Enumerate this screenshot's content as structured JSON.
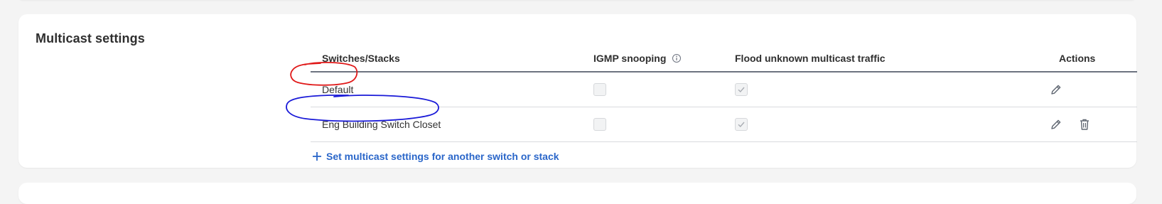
{
  "section": {
    "title": "Multicast settings"
  },
  "table": {
    "columns": {
      "switches": "Switches/Stacks",
      "igmp": "IGMP snooping",
      "flood": "Flood unknown multicast traffic",
      "actions": "Actions"
    },
    "rows": [
      {
        "name": "Default",
        "igmp_snooping": false,
        "flood_unknown": true,
        "actions": [
          "edit"
        ]
      },
      {
        "name": "Eng Building Switch Closet",
        "igmp_snooping": false,
        "flood_unknown": true,
        "actions": [
          "edit",
          "delete"
        ]
      }
    ]
  },
  "add_link": {
    "label": "Set multicast settings for another switch or stack",
    "icon": "plus-icon"
  },
  "annotations": [
    {
      "shape": "ellipse",
      "color": "#e01818",
      "target": "Default"
    },
    {
      "shape": "ellipse",
      "color": "#1a1ad8",
      "target": "Eng Building Switch Closet"
    }
  ],
  "colors": {
    "accent": "#2a66c9",
    "header_border": "#6d7380",
    "row_border": "#d9dbde",
    "background": "#f4f4f4",
    "card": "#ffffff"
  }
}
